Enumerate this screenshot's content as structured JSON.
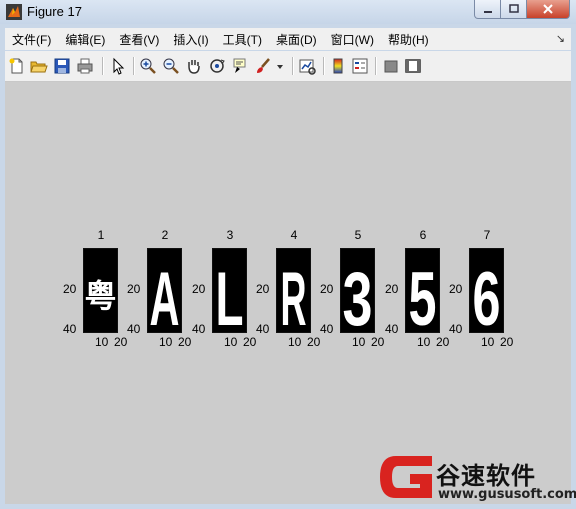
{
  "window": {
    "title": "Figure 17"
  },
  "menubar": {
    "items": [
      "文件(F)",
      "编辑(E)",
      "查看(V)",
      "插入(I)",
      "工具(T)",
      "桌面(D)",
      "窗口(W)",
      "帮助(H)"
    ]
  },
  "toolbar": {
    "icons": [
      "new-figure-icon",
      "open-file-icon",
      "save-icon",
      "print-icon",
      "edit-plot-arrow-icon",
      "zoom-in-icon",
      "zoom-out-icon",
      "pan-hand-icon",
      "rotate-3d-icon",
      "data-cursor-icon",
      "brush-icon",
      "brush-dropdown-icon",
      "link-plot-icon",
      "colorbar-icon",
      "legend-icon",
      "hide-plot-tools-icon",
      "show-plot-tools-icon"
    ]
  },
  "figure": {
    "subplots": [
      {
        "title": "1",
        "glyph": "粤"
      },
      {
        "title": "2",
        "glyph": "A"
      },
      {
        "title": "3",
        "glyph": "L"
      },
      {
        "title": "4",
        "glyph": "R"
      },
      {
        "title": "5",
        "glyph": "3"
      },
      {
        "title": "6",
        "glyph": "5"
      },
      {
        "title": "7",
        "glyph": "6"
      }
    ],
    "yticks": [
      "20",
      "40"
    ],
    "xticks": [
      "10",
      "20"
    ]
  },
  "watermark": {
    "name": "谷速软件",
    "url": "www.gususoft.com"
  }
}
